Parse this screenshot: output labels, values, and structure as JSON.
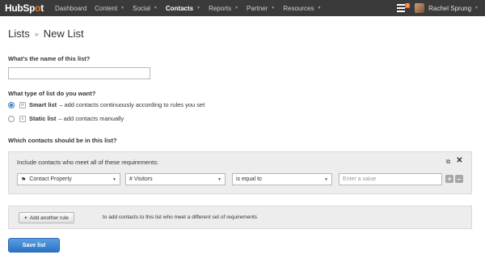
{
  "topbar": {
    "logo_prefix": "HubSp",
    "logo_o": "o",
    "logo_suffix": "t",
    "nav": [
      {
        "label": "Dashboard",
        "dropdown": false
      },
      {
        "label": "Content",
        "dropdown": true
      },
      {
        "label": "Social",
        "dropdown": true
      },
      {
        "label": "Contacts",
        "dropdown": true,
        "active": true
      },
      {
        "label": "Reports",
        "dropdown": true
      },
      {
        "label": "Partner",
        "dropdown": true
      },
      {
        "label": "Resources",
        "dropdown": true
      }
    ],
    "notification_count": "1",
    "user_name": "Rachel Sprung"
  },
  "breadcrumb": {
    "parent": "Lists",
    "separator": "»",
    "current": "New List"
  },
  "form": {
    "name_label": "What's the name of this list?",
    "name_value": "",
    "type_label": "What type of list do you want?",
    "smart_title": "Smart list",
    "smart_desc": "– add contacts continuously according to rules you set",
    "static_title": "Static list",
    "static_desc": "– add contacts manually",
    "selected_type": "smart",
    "contacts_label": "Which contacts should be in this list?"
  },
  "requirements": {
    "title": "Include contacts who meet all of these requirements:",
    "filter_type": "Contact Property",
    "property": "# Visitors",
    "operator": "is equal to",
    "value_placeholder": "Enter a value",
    "plus": "+",
    "minus": "–"
  },
  "add_rule": {
    "button_label": "Add another rule",
    "text": "to add contacts to this list who meet a different set of requirements"
  },
  "save_label": "Save list",
  "colors": {
    "topbar": "#3a3a3a",
    "brand_orange": "#f57722",
    "primary_blue": "#2b74c5",
    "panel_gray": "#ededed"
  }
}
